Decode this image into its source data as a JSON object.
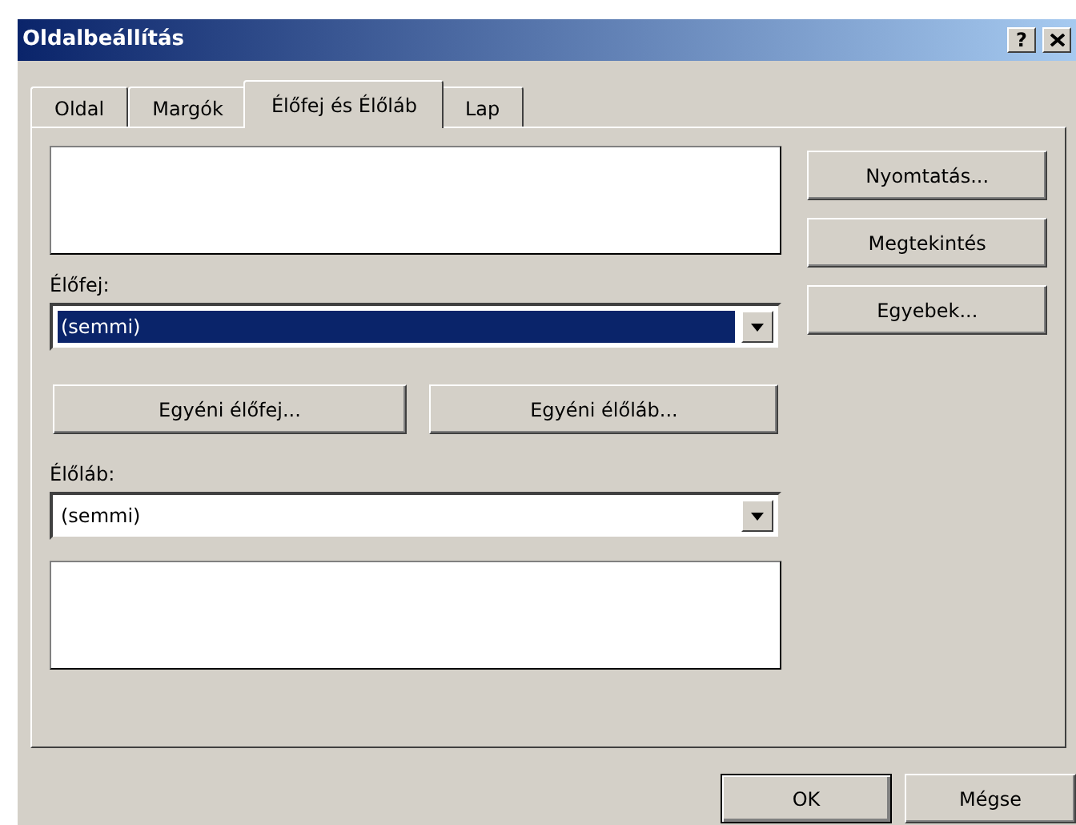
{
  "window": {
    "title": "Oldalbeállítás",
    "help_button": "?"
  },
  "tabs": [
    {
      "label": "Oldal",
      "selected": false
    },
    {
      "label": "Margók",
      "selected": false
    },
    {
      "label": "Élőfej és Élőláb",
      "selected": true
    },
    {
      "label": "Lap",
      "selected": false
    }
  ],
  "header": {
    "label": "Élőfej:",
    "value": "(semmi)",
    "focused": true
  },
  "custom_buttons": [
    "Egyéni élőfej...",
    "Egyéni élőláb..."
  ],
  "footer": {
    "label": "Élőláb:",
    "value": "(semmi)",
    "focused": false
  },
  "side_buttons": [
    "Nyomtatás...",
    "Megtekintés",
    "Egyebek..."
  ],
  "buttons": [
    {
      "label": "OK",
      "default": true
    },
    {
      "label": "Mégse",
      "default": false
    }
  ]
}
